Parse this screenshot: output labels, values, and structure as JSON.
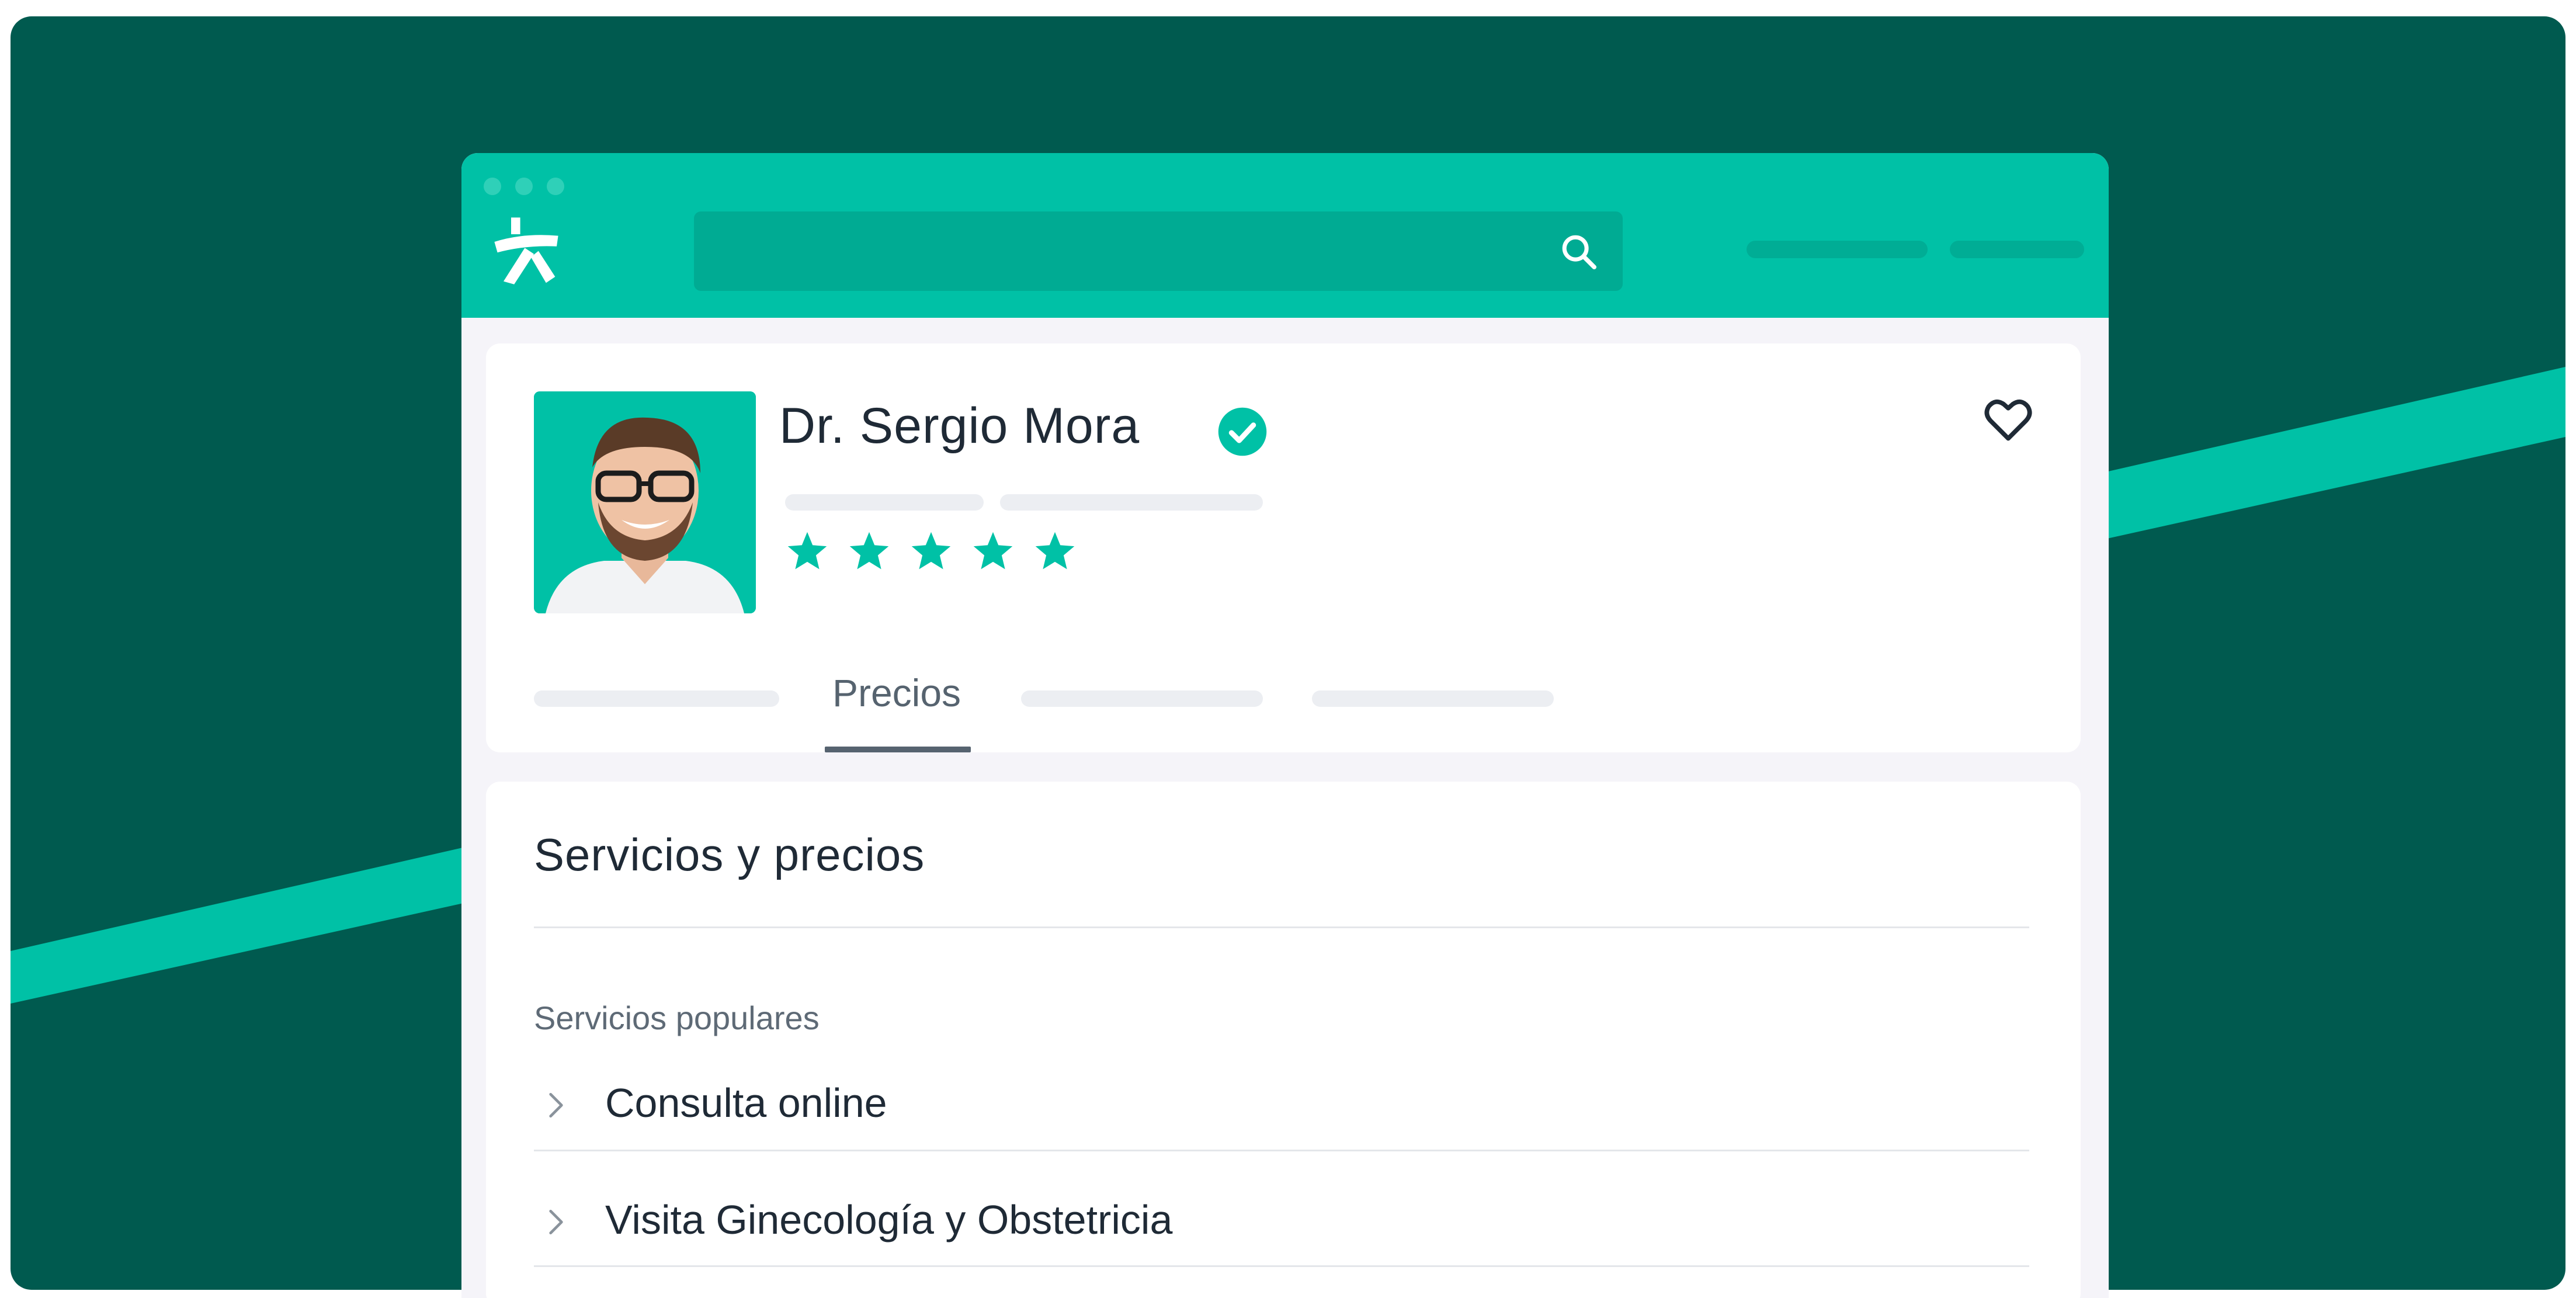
{
  "colors": {
    "brand": "#00c1a6",
    "brand_dark": "#005a4f",
    "text": "#1f2a36",
    "muted": "#5e6a76"
  },
  "profile": {
    "name": "Dr. Sergio Mora",
    "rating_stars": 5,
    "active_tab": "Precios"
  },
  "services": {
    "title": "Servicios y precios",
    "subheading": "Servicios populares",
    "items": [
      {
        "label": "Consulta online"
      },
      {
        "label": "Visita Ginecología y Obstetricia"
      }
    ]
  }
}
